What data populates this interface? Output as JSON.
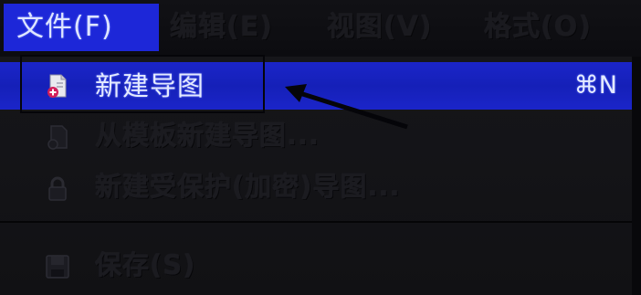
{
  "menubar": {
    "menus": [
      {
        "label": "文件(F)"
      },
      {
        "label": "编辑(E)"
      },
      {
        "label": "视图(V)"
      },
      {
        "label": "格式(O)"
      }
    ]
  },
  "file_menu": {
    "items": [
      {
        "label": "新建导图",
        "shortcut": "⌘N",
        "icon": "new-map-icon"
      },
      {
        "label": "从模板新建导图...",
        "icon": "template-icon"
      },
      {
        "label": "新建受保护(加密)导图...",
        "icon": "lock-icon"
      },
      {
        "label": "保存(S)",
        "icon": "save-icon"
      }
    ]
  },
  "colors": {
    "highlight": "#1d27d8",
    "menu_background": "#141418",
    "highlight_text": "#e4eaff"
  }
}
